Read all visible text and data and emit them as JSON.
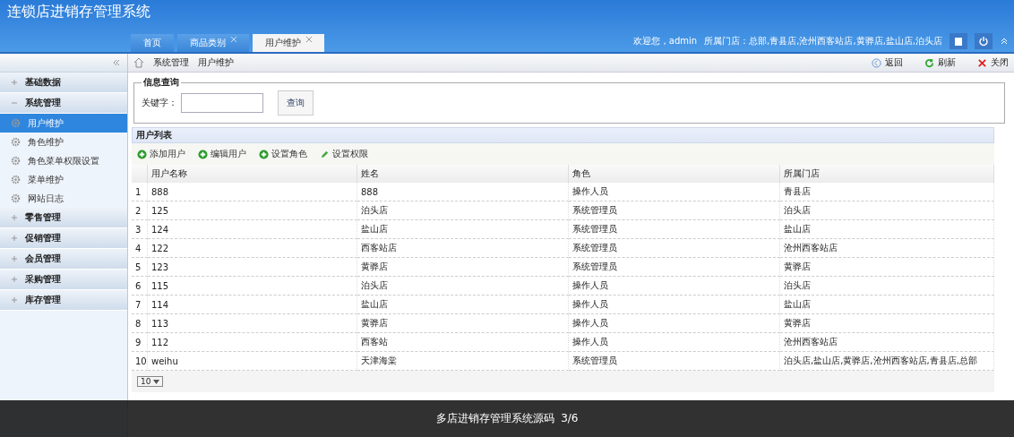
{
  "app_title": "连锁店进销存管理系统",
  "tabs": [
    {
      "label": "首页",
      "selected": false,
      "closable": false
    },
    {
      "label": "商品类别",
      "selected": false,
      "closable": true
    },
    {
      "label": "用户维护",
      "selected": true,
      "closable": true
    }
  ],
  "user_bar": {
    "welcome": "欢迎您，admin",
    "stores": "所属门店：总部,青县店,沧州西客站店,黄骅店,盐山店,泊头店"
  },
  "breadcrumb": [
    "系统管理",
    "用户维护"
  ],
  "actions": [
    {
      "kind": "back",
      "label": "返回"
    },
    {
      "kind": "refresh",
      "label": "刷新"
    },
    {
      "kind": "close",
      "label": "关闭"
    }
  ],
  "sidebar": [
    {
      "label": "基础数据",
      "expanded": false
    },
    {
      "label": "系统管理",
      "expanded": true,
      "children": [
        {
          "label": "用户维护",
          "selected": true
        },
        {
          "label": "角色维护",
          "selected": false
        },
        {
          "label": "角色菜单权限设置",
          "selected": false
        },
        {
          "label": "菜单维护",
          "selected": false
        },
        {
          "label": "网站日志",
          "selected": false
        }
      ]
    },
    {
      "label": "零售管理",
      "expanded": false
    },
    {
      "label": "促销管理",
      "expanded": false
    },
    {
      "label": "会员管理",
      "expanded": false
    },
    {
      "label": "采购管理",
      "expanded": false
    },
    {
      "label": "库存管理",
      "expanded": false
    }
  ],
  "search": {
    "legend": "信息查询",
    "label": "关键字：",
    "button": "查询"
  },
  "list": {
    "title": "用户列表",
    "toolbar": [
      {
        "kind": "add",
        "label": "添加用户"
      },
      {
        "kind": "add",
        "label": "编辑用户"
      },
      {
        "kind": "add",
        "label": "设置角色"
      },
      {
        "kind": "edit",
        "label": "设置权限"
      }
    ],
    "columns": [
      "",
      "用户名称",
      "姓名",
      "角色",
      "所属门店"
    ],
    "rows": [
      [
        "1",
        "888",
        "888",
        "操作人员",
        "青县店"
      ],
      [
        "2",
        "125",
        "泊头店",
        "系统管理员",
        "泊头店"
      ],
      [
        "3",
        "124",
        "盐山店",
        "系统管理员",
        "盐山店"
      ],
      [
        "4",
        "122",
        "西客站店",
        "系统管理员",
        "沧州西客站店"
      ],
      [
        "5",
        "123",
        "黄骅店",
        "系统管理员",
        "黄骅店"
      ],
      [
        "6",
        "115",
        "泊头店",
        "操作人员",
        "泊头店"
      ],
      [
        "7",
        "114",
        "盐山店",
        "操作人员",
        "盐山店"
      ],
      [
        "8",
        "113",
        "黄骅店",
        "操作人员",
        "黄骅店"
      ],
      [
        "9",
        "112",
        "西客站",
        "操作人员",
        "沧州西客站店"
      ],
      [
        "10",
        "weihu",
        "天津海棠",
        "系统管理员",
        "泊头店,盐山店,黄骅店,沧州西客站店,青县店,总部"
      ]
    ],
    "page_size": "10"
  },
  "caption": "多店进销存管理系统源码  3/6"
}
